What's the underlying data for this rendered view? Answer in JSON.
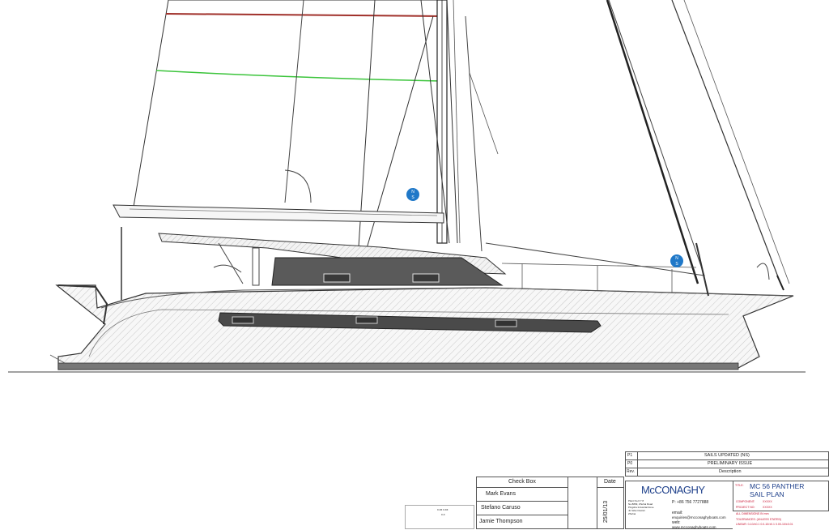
{
  "revisions": [
    {
      "rev": "P1",
      "description": "SAILS UPDATED (NS)"
    },
    {
      "rev": "P0",
      "description": "PRELIMINARY ISSUE"
    }
  ],
  "revision_header": {
    "rev": "Rev.",
    "description": "Description"
  },
  "check_box": {
    "header": "Check Box",
    "date_header": "Date",
    "names": [
      "Mark Evans",
      "Stefano Caruso",
      "Jamie Thompson"
    ],
    "date": "25/01/13"
  },
  "company": {
    "logo": "McCONAGHY",
    "phone": "P: +86 756 7727888",
    "email_label": "email:",
    "email": "enquiries@mcconaghyboats.com",
    "web_label": "web:",
    "web": "www.mcconaghyboats.com",
    "address": "Plant No.6 7 8\nNo.8809, Zhuhai Road\nPingsha Industrial Zone\nJin Wan District\nZhuhai"
  },
  "title_block": {
    "title_label": "TITLE:",
    "title_line1": "MC 56 PANTHER",
    "title_line2": "SAIL PLAN",
    "component_label": "COMPONENT:",
    "component": "XXXXX",
    "project_label": "PROJECT NO:",
    "project": "XXXXX",
    "dims_note": "ALL DIMENSIONS IN mm",
    "tolerances": "TOLERANCES: (UNLESS STATED)",
    "linear": "LINEAR: 0-10/±0.1   0.0-10/±0.1   0.00-10/±0.01"
  },
  "small_box": {
    "line1": "x.xx x.xx",
    "line2": "x.x"
  },
  "colors": {
    "red_line": "#a0302a",
    "green_line": "#3bc43b",
    "hull_line": "#444444",
    "window": "#555555",
    "badge": "#1f78c8"
  },
  "icons": [
    "north-south-badge-icon"
  ]
}
